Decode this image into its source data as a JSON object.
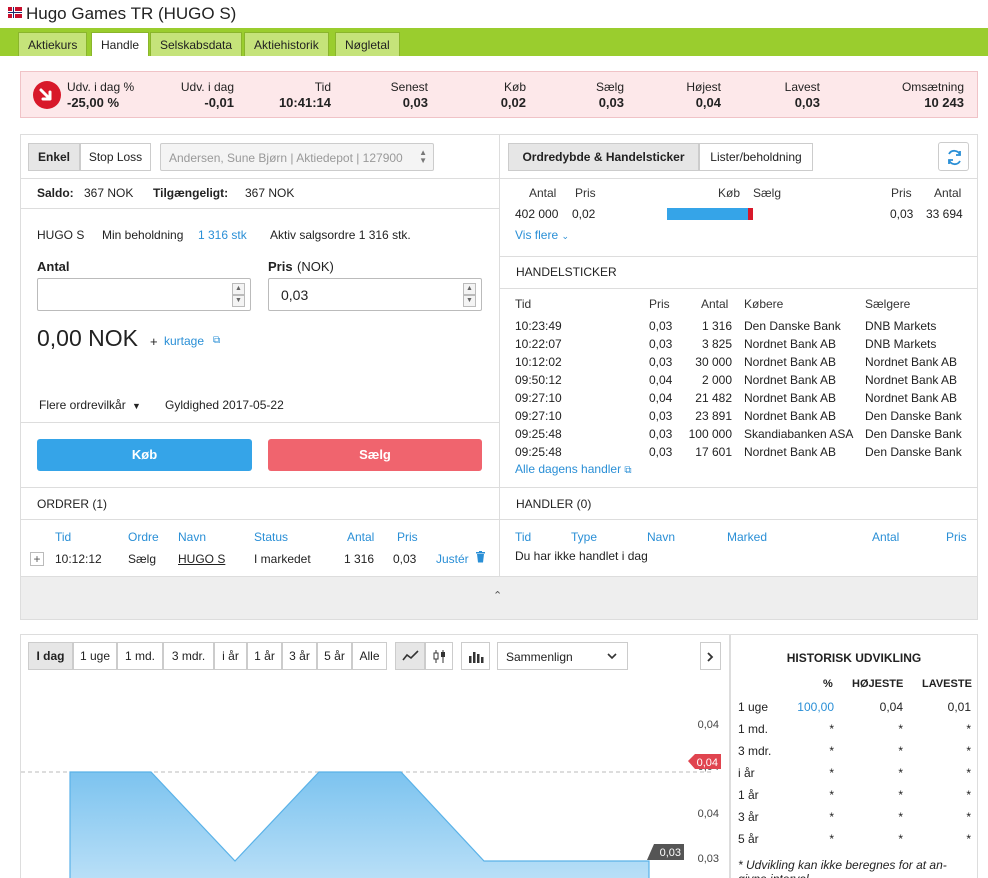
{
  "header": {
    "title": "Hugo Games TR (HUGO S)"
  },
  "nav": {
    "tabs": [
      "Aktiekurs",
      "Handle",
      "Selskabsdata",
      "Aktiehistorik",
      "Nøgletal"
    ],
    "active": "Handle"
  },
  "quote": {
    "change_pct_label": "Udv. i dag %",
    "change_pct": "-25,00 %",
    "change_label": "Udv. i dag",
    "change": "-0,01",
    "time_label": "Tid",
    "time": "10:41:14",
    "last_label": "Senest",
    "last": "0,03",
    "bid_label": "Køb",
    "bid": "0,02",
    "ask_label": "Sælg",
    "ask": "0,03",
    "high_label": "Højest",
    "high": "0,04",
    "low_label": "Lavest",
    "low": "0,03",
    "turnover_label": "Omsætning",
    "turnover": "10 243"
  },
  "order_form": {
    "tab_simple": "Enkel",
    "tab_stoploss": "Stop Loss",
    "account_select": "Andersen, Sune Bjørn | Aktiedepot | 127900",
    "saldo_label": "Saldo:",
    "saldo": "367 NOK",
    "available_label": "Tilgængeligt:",
    "available": "367 NOK",
    "ticker": "HUGO S",
    "min_holding_label": "Min beholdning",
    "min_holding": "1 316 stk",
    "active_sell": "Aktiv salgsordre 1 316 stk.",
    "qty_label": "Antal",
    "qty_value": "",
    "price_label": "Pris",
    "price_unit": "(NOK)",
    "price_value": "0,03",
    "total": "0,00 NOK",
    "plus": "+",
    "brokerage_link": "kurtage",
    "more_terms": "Flere ordrevilkår",
    "validity": "Gyldighed 2017-05-22",
    "buy_btn": "Køb",
    "sell_btn": "Sælg"
  },
  "depth": {
    "tab_depth": "Ordredybde & Handelsticker",
    "tab_lists": "Lister/beholdning",
    "headers": {
      "qty": "Antal",
      "price": "Pris",
      "buy": "Køb",
      "sell": "Sælg",
      "price2": "Pris",
      "qty2": "Antal"
    },
    "row": {
      "bid_qty": "402 000",
      "bid_price": "0,02",
      "ask_price": "0,03",
      "ask_qty": "33 694",
      "buy_share": 0.94
    },
    "show_more": "Vis flere"
  },
  "ticker": {
    "title": "HANDELSTICKER",
    "headers": [
      "Tid",
      "Pris",
      "Antal",
      "Købere",
      "Sælgere"
    ],
    "rows": [
      [
        "10:23:49",
        "0,03",
        "1 316",
        "Den Danske Bank",
        "DNB Markets"
      ],
      [
        "10:22:07",
        "0,03",
        "3 825",
        "Nordnet Bank AB",
        "DNB Markets"
      ],
      [
        "10:12:02",
        "0,03",
        "30 000",
        "Nordnet Bank AB",
        "Nordnet Bank AB"
      ],
      [
        "09:50:12",
        "0,04",
        "2 000",
        "Nordnet Bank AB",
        "Nordnet Bank AB"
      ],
      [
        "09:27:10",
        "0,04",
        "21 482",
        "Nordnet Bank AB",
        "Nordnet Bank AB"
      ],
      [
        "09:27:10",
        "0,03",
        "23 891",
        "Nordnet Bank AB",
        "Den Danske Bank"
      ],
      [
        "09:25:48",
        "0,03",
        "100 000",
        "Skandiabanken ASA",
        "Den Danske Bank"
      ],
      [
        "09:25:48",
        "0,03",
        "17 601",
        "Nordnet Bank AB",
        "Den Danske Bank"
      ]
    ],
    "all_trades": "Alle dagens handler"
  },
  "orders": {
    "title": "ORDRER (1)",
    "headers": [
      "Tid",
      "Ordre",
      "Navn",
      "Status",
      "Antal",
      "Pris"
    ],
    "row": {
      "time": "10:12:12",
      "type": "Sælg",
      "name": "HUGO S",
      "status": "I markedet",
      "qty": "1 316",
      "price": "0,03",
      "adjust": "Justér"
    }
  },
  "trades": {
    "title": "HANDLER (0)",
    "headers": [
      "Tid",
      "Type",
      "Navn",
      "Marked",
      "Antal",
      "Pris"
    ],
    "empty": "Du har ikke handlet i dag"
  },
  "chart_controls": {
    "periods": [
      "I dag",
      "1 uge",
      "1 md.",
      "3 mdr.",
      "i år",
      "1 år",
      "3 år",
      "5 år",
      "Alle"
    ],
    "active": "I dag",
    "compare": "Sammenlign"
  },
  "chart_data": {
    "type": "area",
    "x": [
      0,
      1,
      2,
      3,
      4,
      5,
      6,
      7
    ],
    "values": [
      0.04,
      0.04,
      0.03,
      0.04,
      0.04,
      0.03,
      0.03,
      0.03
    ],
    "ylim": [
      0.03,
      0.04
    ],
    "yticks": [
      "0,04",
      "0,04",
      "0,04",
      "0,03"
    ],
    "marker_high": "0,04",
    "marker_last": "0,03",
    "title": "",
    "xlabel": "",
    "ylabel": ""
  },
  "history": {
    "title": "HISTORISK UDVIKLING",
    "headers": [
      "%",
      "HØJESTE",
      "LAVESTE"
    ],
    "rows": [
      [
        "1 uge",
        "100,00",
        "0,04",
        "0,01"
      ],
      [
        "1 md.",
        "*",
        "*",
        "*"
      ],
      [
        "3 mdr.",
        "*",
        "*",
        "*"
      ],
      [
        "i år",
        "*",
        "*",
        "*"
      ],
      [
        "1 år",
        "*",
        "*",
        "*"
      ],
      [
        "3 år",
        "*",
        "*",
        "*"
      ],
      [
        "5 år",
        "*",
        "*",
        "*"
      ]
    ],
    "note": "* Udvikling kan ikke beregnes for at an- givne interval"
  },
  "colors": {
    "nav": "#9acd2e",
    "buy": "#35a4e8",
    "sell": "#f0646e",
    "link": "#2a8fd6",
    "down": "#d8182a"
  }
}
